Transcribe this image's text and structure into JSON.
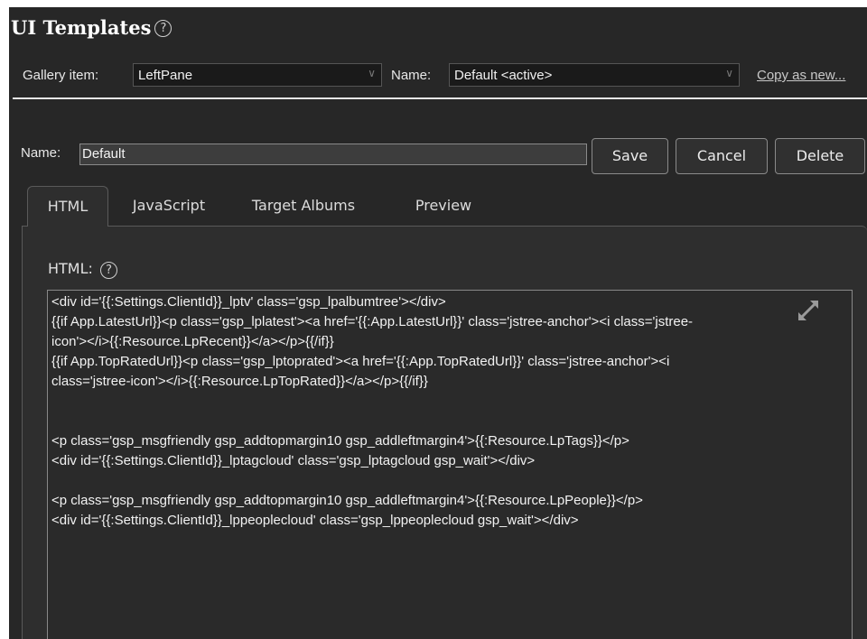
{
  "page": {
    "title": "UI Templates",
    "help_glyph": "?"
  },
  "gallery": {
    "gallery_item_label": "Gallery item:",
    "gallery_item_value": "LeftPane",
    "name_label": "Name:",
    "name_value": "Default <active>",
    "copy_link": "Copy as new..."
  },
  "editor": {
    "name_label": "Name:",
    "name_value": "Default",
    "save_label": "Save",
    "cancel_label": "Cancel",
    "delete_label": "Delete"
  },
  "tabs": [
    {
      "label": "HTML",
      "active": true
    },
    {
      "label": "JavaScript",
      "active": false
    },
    {
      "label": "Target Albums",
      "active": false
    },
    {
      "label": "Preview",
      "active": false
    }
  ],
  "html_panel": {
    "label": "HTML:",
    "code_lines": [
      "<div id='{{:Settings.ClientId}}_lptv' class='gsp_lpalbumtree'></div>",
      "{{if App.LatestUrl}}<p class='gsp_lplatest'><a href='{{:App.LatestUrl}}' class='jstree-anchor'><i class='jstree-",
      "icon'></i>{{:Resource.LpRecent}}</a></p>{{/if}}",
      "{{if App.TopRatedUrl}}<p class='gsp_lptoprated'><a href='{{:App.TopRatedUrl}}' class='jstree-anchor'><i",
      "class='jstree-icon'></i>{{:Resource.LpTopRated}}</a></p>{{/if}}",
      "",
      "",
      "<p class='gsp_msgfriendly gsp_addtopmargin10 gsp_addleftmargin4'>{{:Resource.LpTags}}</p>",
      "<div id='{{:Settings.ClientId}}_lptagcloud' class='gsp_lptagcloud gsp_wait'></div>",
      "",
      "<p class='gsp_msgfriendly gsp_addtopmargin10 gsp_addleftmargin4'>{{:Resource.LpPeople}}</p>",
      "<div id='{{:Settings.ClientId}}_lppeoplecloud' class='gsp_lppeoplecloud gsp_wait'></div>"
    ]
  },
  "icons": {
    "help": "help-circle-icon",
    "chevron": "chevron-down-icon",
    "expand": "expand-icon"
  },
  "colors": {
    "panel_bg": "#272727",
    "tab_body_bg": "#2e2e2e",
    "text": "#f2f2f2"
  }
}
